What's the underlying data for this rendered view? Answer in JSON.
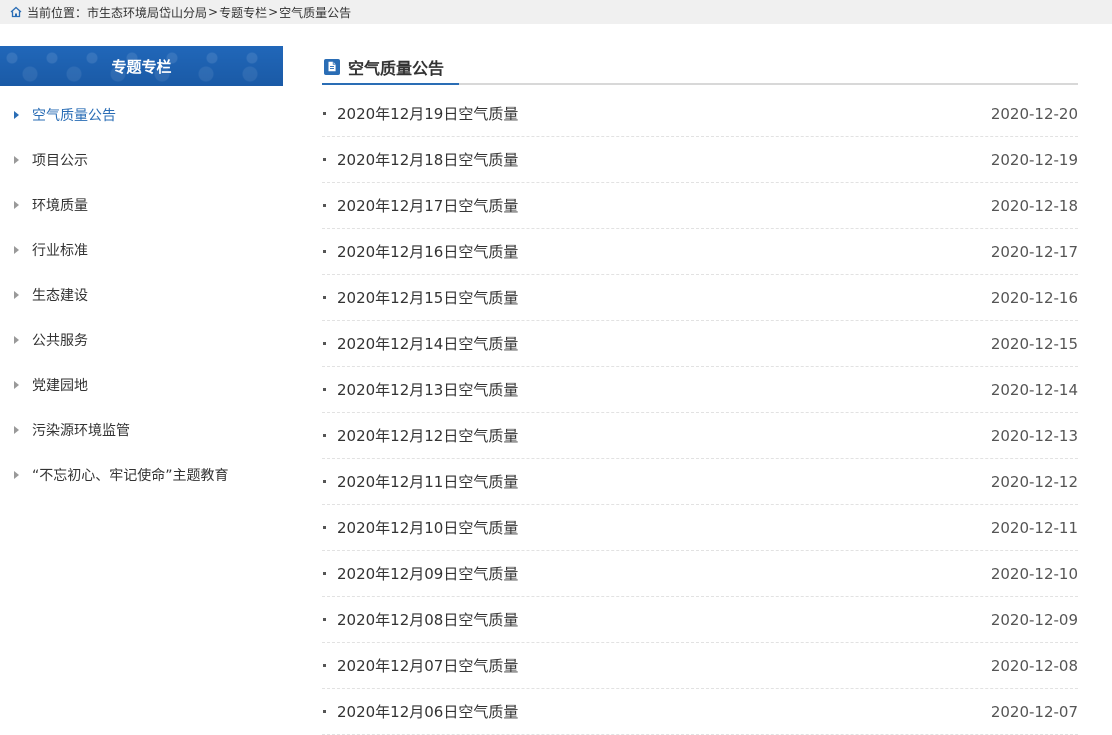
{
  "breadcrumb": {
    "prefix": "当前位置：",
    "items": [
      "市生态环境局岱山分局",
      "专题专栏",
      "空气质量公告"
    ],
    "separator": ">"
  },
  "sidebar": {
    "header": "专题专栏",
    "items": [
      {
        "label": "空气质量公告",
        "active": true
      },
      {
        "label": "项目公示"
      },
      {
        "label": "环境质量"
      },
      {
        "label": "行业标准"
      },
      {
        "label": "生态建设"
      },
      {
        "label": "公共服务"
      },
      {
        "label": "党建园地"
      },
      {
        "label": "污染源环境监管"
      },
      {
        "label": "“不忘初心、牢记使命”主题教育"
      }
    ]
  },
  "main": {
    "title": "空气质量公告",
    "articles": [
      {
        "title": "2020年12月19日空气质量",
        "date": "2020-12-20"
      },
      {
        "title": "2020年12月18日空气质量",
        "date": "2020-12-19"
      },
      {
        "title": "2020年12月17日空气质量",
        "date": "2020-12-18"
      },
      {
        "title": "2020年12月16日空气质量",
        "date": "2020-12-17"
      },
      {
        "title": "2020年12月15日空气质量",
        "date": "2020-12-16"
      },
      {
        "title": "2020年12月14日空气质量",
        "date": "2020-12-15"
      },
      {
        "title": "2020年12月13日空气质量",
        "date": "2020-12-14"
      },
      {
        "title": "2020年12月12日空气质量",
        "date": "2020-12-13"
      },
      {
        "title": "2020年12月11日空气质量",
        "date": "2020-12-12"
      },
      {
        "title": "2020年12月10日空气质量",
        "date": "2020-12-11"
      },
      {
        "title": "2020年12月09日空气质量",
        "date": "2020-12-10"
      },
      {
        "title": "2020年12月08日空气质量",
        "date": "2020-12-09"
      },
      {
        "title": "2020年12月07日空气质量",
        "date": "2020-12-08"
      },
      {
        "title": "2020年12月06日空气质量",
        "date": "2020-12-07"
      }
    ]
  },
  "colors": {
    "accent": "#2a6db5",
    "sidebar_header_bg": "#1b5fb0"
  },
  "icons": {
    "breadcrumb": "home-icon",
    "title": "document-icon"
  }
}
